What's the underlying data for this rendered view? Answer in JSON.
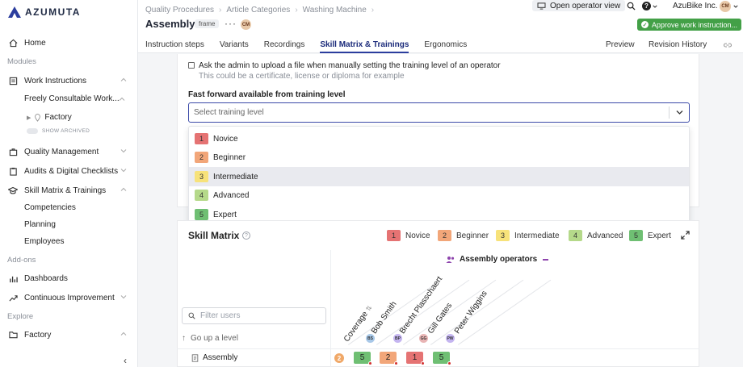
{
  "brand": {
    "name": "AZUMUTA"
  },
  "sidebar": {
    "home": "Home",
    "modules_label": "Modules",
    "work_instructions": "Work Instructions",
    "freely": "Freely Consultable Work...",
    "factory_tree": "Factory",
    "show_archived": "SHOW ARCHIVED",
    "quality_management": "Quality Management",
    "audits": "Audits & Digital Checklists",
    "skill_matrix": "Skill Matrix & Trainings",
    "competencies": "Competencies",
    "planning": "Planning",
    "employees": "Employees",
    "addons_label": "Add-ons",
    "dashboards": "Dashboards",
    "continuous": "Continuous Improvement",
    "explore_label": "Explore",
    "factory": "Factory"
  },
  "header": {
    "breadcrumbs": [
      "Quality Procedures",
      "Article Categories",
      "Washing Machine"
    ],
    "title": "Assembly",
    "badge": "frame",
    "avatar": "CM",
    "operator_view": "Open operator view",
    "org": "AzuBike Inc.",
    "user_avatar": "CM",
    "approve": "Approve work instruction...",
    "tabs": [
      "Instruction steps",
      "Variants",
      "Recordings",
      "Skill Matrix & Trainings",
      "Ergonomics"
    ],
    "preview": "Preview",
    "revision_history": "Revision History"
  },
  "settings": {
    "checkbox_label": "Ask the admin to upload a file when manually setting the training level of an operator",
    "checkbox_hint": "This could be a certificate, license or diploma for example",
    "ff_label": "Fast forward available from training level",
    "select_placeholder": "Select training level"
  },
  "levels": [
    {
      "num": "1",
      "name": "Novice",
      "color": "#e57373"
    },
    {
      "num": "2",
      "name": "Beginner",
      "color": "#f2a679"
    },
    {
      "num": "3",
      "name": "Intermediate",
      "color": "#f7e27a"
    },
    {
      "num": "4",
      "name": "Advanced",
      "color": "#b5d98a"
    },
    {
      "num": "5",
      "name": "Expert",
      "color": "#6fbf73"
    }
  ],
  "matrix": {
    "title": "Skill Matrix",
    "group": "Assembly operators",
    "filter_placeholder": "Filter users",
    "go_up": "Go up a level",
    "columns": [
      {
        "label": "Coverage",
        "initials": ""
      },
      {
        "label": "Bob Smith",
        "initials": "BS",
        "color": "#a8c8e8"
      },
      {
        "label": "Brecht Plasschaert",
        "initials": "BP",
        "color": "#c4b5f0"
      },
      {
        "label": "Gill Gates",
        "initials": "GG",
        "color": "#e8b4b4"
      },
      {
        "label": "Peter Wiggins",
        "initials": "PW",
        "color": "#c4b5f0"
      }
    ],
    "row_label": "Assembly",
    "coverage_value": "2",
    "cells": [
      "5",
      "2",
      "1",
      "5"
    ]
  }
}
